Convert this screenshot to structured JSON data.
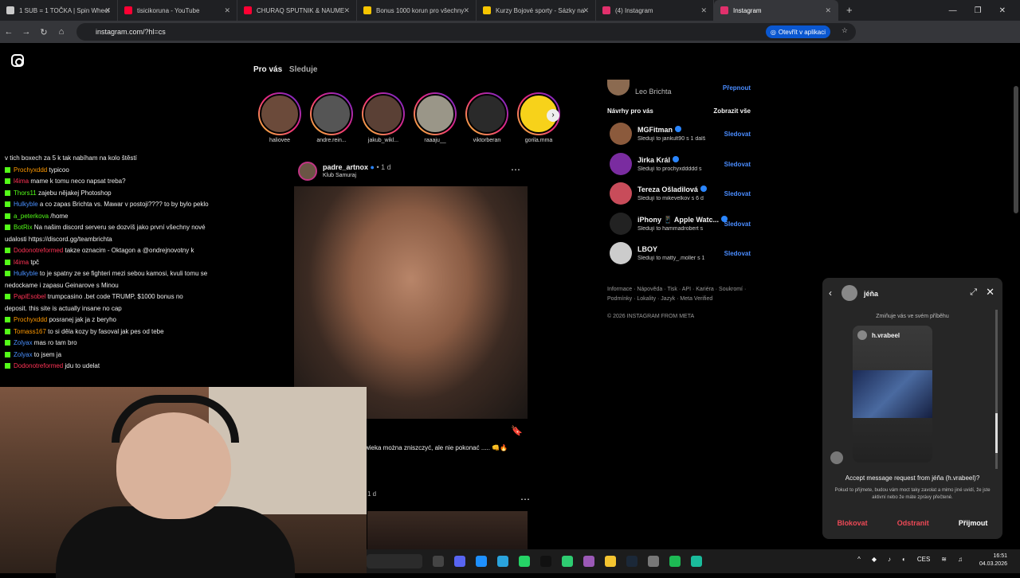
{
  "tabs": [
    {
      "label": "1 SUB = 1 TOČKA | Spin Wheel",
      "color": "#c9c9c9"
    },
    {
      "label": "tisicikoruna - YouTube",
      "color": "#ff0033"
    },
    {
      "label": "CHURAQ SPUTNIK & NAUME",
      "color": "#ff0033"
    },
    {
      "label": "Bonus 1000 korun pro všechny",
      "color": "#f7c500"
    },
    {
      "label": "Kurzy Bojové sporty - Sázky na",
      "color": "#f7c500"
    },
    {
      "label": "(4) Instagram",
      "color": "#e1306c"
    },
    {
      "label": "Instagram",
      "color": "#e1306c"
    }
  ],
  "address": {
    "url": "instagram.com/?hl=cs",
    "open_app": "Otevřít v aplikaci"
  },
  "feed": {
    "tab_for_you": "Pro vás",
    "tab_following": "Sleduje"
  },
  "stories": [
    {
      "name": "haliovee",
      "color": "#6b4a3a"
    },
    {
      "name": "andre.rein...",
      "color": "#555"
    },
    {
      "name": "jakub_wikl...",
      "color": "#5a4035"
    },
    {
      "name": "raaaju__",
      "color": "#9a9688"
    },
    {
      "name": "viktorberan",
      "color": "#2a2a2a"
    },
    {
      "name": "gorila.mma",
      "color": "#f7d21a"
    }
  ],
  "post": {
    "user": "padre_artnox",
    "time": "1 d",
    "location": "Klub Samuraj",
    "caption": "wieka można zniszczyć, ale nie pokonać ..... 👊🔥",
    "post2_time": "1 d"
  },
  "sidebar": {
    "me_name": "Leo Brichta",
    "switch": "Přepnout",
    "suggestions_title": "Návrhy pro vás",
    "see_all": "Zobrazit vše",
    "follow_label": "Sledovat",
    "suggestions": [
      {
        "name": "MGFitman",
        "sub": "Sledují to jankult90 s 1 dalš",
        "color": "#8b5a3c",
        "verified": "✓"
      },
      {
        "name": "Jirka Král",
        "sub": "Sledují to prochyxddddd s",
        "color": "#7a2ca0",
        "verified": "✓"
      },
      {
        "name": "Tereza Ošladilová",
        "sub": "Sledují to mikevelkov s 6 d",
        "color": "#c84c5a",
        "verified": "✓"
      },
      {
        "name": "iPhony 📱 Apple Watc...",
        "sub": "Sledují to hammadrobert s",
        "color": "#222",
        "verified": "✓"
      },
      {
        "name": "LBOY",
        "sub": "Sledují to matty_.moller s 1",
        "color": "#ccc",
        "verified": ""
      }
    ],
    "footer": "Informace · Nápověda · Tisk · API · Kariéra · Soukromí · Podmínky · Lokality · Jazyk · Meta Verified",
    "copyright": "© 2026 INSTAGRAM FROM META"
  },
  "chat": [
    {
      "user": "",
      "msg": "v tich boxech za 5 k tak nabíham na kolo štěstí",
      "color": "#ffffff"
    },
    {
      "user": "Prochyxddd",
      "msg": "typicoo",
      "color": "#ff9900"
    },
    {
      "user": "l4ima",
      "msg": "mame k tomu neco napsat treba?",
      "color": "#ff3355"
    },
    {
      "user": "Thors11",
      "msg": "zajebu nějakej Photoshop",
      "color": "#53fc18"
    },
    {
      "user": "Hulkyble",
      "msg": "a co zapas Brichta vs. Mawar v postoji???? to by bylo peklo",
      "color": "#4a90ff"
    },
    {
      "user": "a_peterkova",
      "msg": "/home",
      "color": "#53fc18"
    },
    {
      "user": "BotRix",
      "msg": "Na našim discord serveru se dozvíš jako první všechny nové",
      "color": "#53fc18"
    },
    {
      "user": "",
      "msg": "udalosti https://discord.gg/teambrichta",
      "color": "#ffffff"
    },
    {
      "user": "Dodonotreformed",
      "msg": "takze oznacim - Oktagon a @ondrejnovotny k",
      "color": "#ff3355"
    },
    {
      "user": "l4ima",
      "msg": "tpč",
      "color": "#ff3355"
    },
    {
      "user": "Hulkyble",
      "msg": "to je spatny ze se fighteri mezi sebou kamosi, kvuli tomu se",
      "color": "#4a90ff"
    },
    {
      "user": "",
      "msg": "nedockame i zapasu Geinarove s Minou",
      "color": "#ffffff"
    },
    {
      "user": "PapiEsobel",
      "msg": "trumpcasino .bet code TRUMP, $1000 bonus no",
      "color": "#ff3355"
    },
    {
      "user": "",
      "msg": "deposit. this site is actually insane no cap",
      "color": "#ffffff"
    },
    {
      "user": "Prochyxddd",
      "msg": "posranej jak ja z beryho",
      "color": "#ff9900"
    },
    {
      "user": "Tomass167",
      "msg": "to si děla kozy by fasoval jak pes od tebe",
      "color": "#ff9900"
    },
    {
      "user": "Zolyax",
      "msg": "mas ro tam bro",
      "color": "#4a90ff"
    },
    {
      "user": "Zolyax",
      "msg": "to jsem ja",
      "color": "#4a90ff"
    },
    {
      "user": "Dodonotreformed",
      "msg": "jdu to udelat",
      "color": "#ff3355"
    }
  ],
  "dm": {
    "name": "jéňa",
    "note": "Zmiňuje vás ve svém příběhu",
    "reply_user": "h.vrabeel",
    "request_text": "Accept message request from jéňa (h.vrabeel)?",
    "request_sub": "Pokud to přijmete, budou vám moct taky zavolat a mimo jiné uvidí, že jste aktivní nebo že máte zprávy přečtené.",
    "block": "Blokovat",
    "delete": "Odstranit",
    "accept": "Přijmout"
  },
  "taskbar": {
    "lang": "CES",
    "time": "16:51",
    "date": "04.03.2026",
    "apps": [
      "#444",
      "#5865f2",
      "#1e90ff",
      "#2aa3dc",
      "#25d366",
      "#111",
      "#2ecc71",
      "#9b59b6",
      "#f4c430",
      "#1b2838",
      "#777",
      "#1db954",
      "#1abc9c"
    ]
  }
}
